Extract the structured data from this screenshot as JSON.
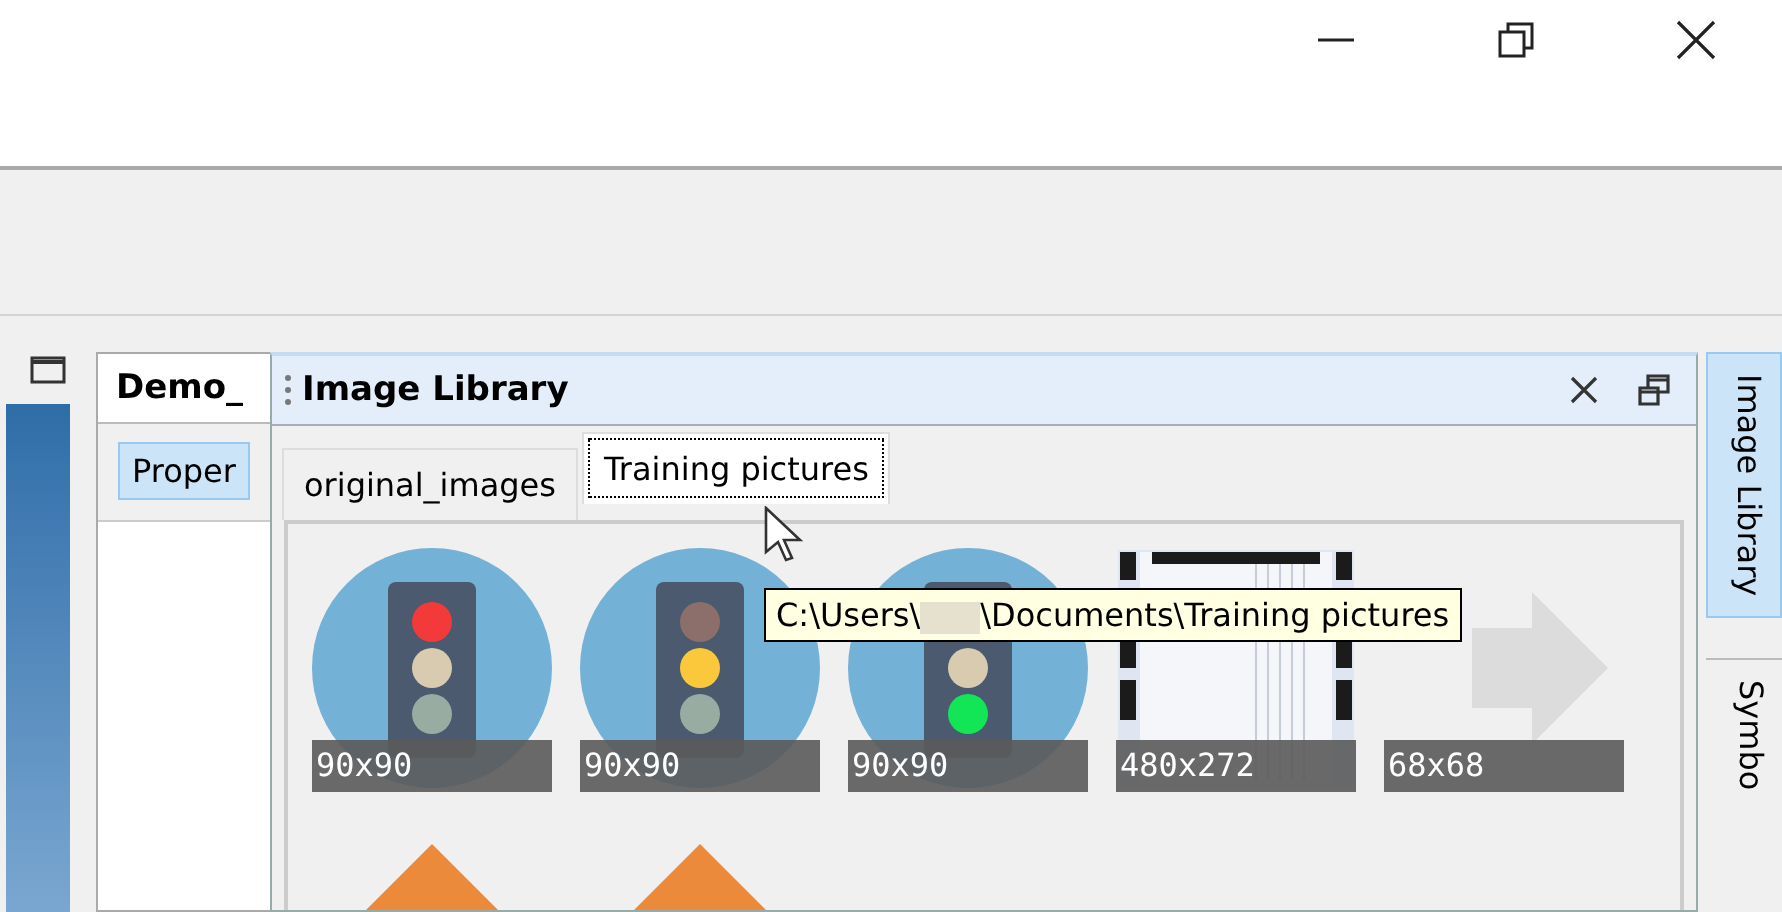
{
  "document_panel": {
    "tab": "Demo_",
    "button": "Proper"
  },
  "image_library": {
    "title": "Image Library",
    "tabs": [
      {
        "label": "original_images",
        "selected": false
      },
      {
        "label": "Training pictures",
        "selected": true
      }
    ],
    "thumbnails": [
      {
        "kind": "traffic-light",
        "lamps": [
          {
            "on": true
          },
          {
            "on": false
          },
          {
            "on": false
          }
        ],
        "size": "90x90"
      },
      {
        "kind": "traffic-light",
        "lamps": [
          {
            "on": false
          },
          {
            "on": true
          },
          {
            "on": false
          }
        ],
        "size": "90x90"
      },
      {
        "kind": "traffic-light",
        "lamps": [
          {
            "on": false
          },
          {
            "on": true
          }
        ],
        "size": "90x90"
      },
      {
        "kind": "screen",
        "size": "480x272"
      },
      {
        "kind": "arrow",
        "size": "68x68"
      },
      {
        "kind": "up-arrow"
      },
      {
        "kind": "up-arrow"
      }
    ],
    "tooltip": {
      "before": "C:\\Users\\",
      "after": "\\Documents\\Training pictures"
    }
  },
  "side_tabs": [
    {
      "label": "Image Library",
      "selected": true
    },
    {
      "label": "Symbo",
      "selected": false
    }
  ]
}
